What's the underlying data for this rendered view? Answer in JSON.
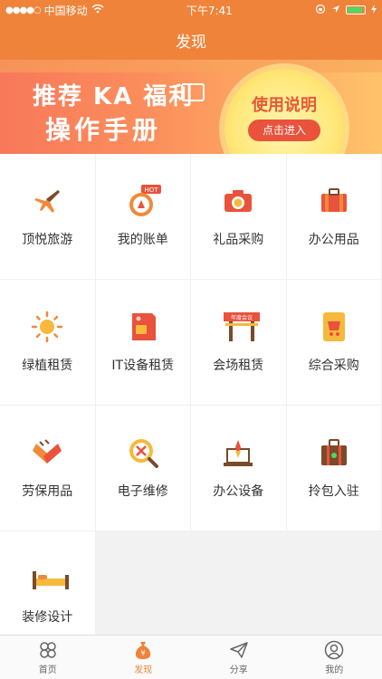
{
  "status": {
    "carrier": "中国移动",
    "time": "下午7:41"
  },
  "nav": {
    "title": "发现"
  },
  "banner": {
    "line1": "推荐 KA 福利",
    "line2": "操作手册",
    "badge_title": "使用说明",
    "badge_button": "点击进入"
  },
  "grid": [
    {
      "label": "顶悦旅游",
      "icon": "airplane-icon"
    },
    {
      "label": "我的账单",
      "icon": "compass-hot-icon",
      "badge": "HOT"
    },
    {
      "label": "礼品采购",
      "icon": "camera-icon"
    },
    {
      "label": "办公用品",
      "icon": "briefcase-icon"
    },
    {
      "label": "绿植租赁",
      "icon": "sun-icon"
    },
    {
      "label": "IT设备租赁",
      "icon": "sim-card-icon"
    },
    {
      "label": "会场租赁",
      "icon": "conference-stage-icon",
      "sign": "年度会议"
    },
    {
      "label": "综合采购",
      "icon": "shopping-cart-icon"
    },
    {
      "label": "劳保用品",
      "icon": "gloves-icon"
    },
    {
      "label": "电子维修",
      "icon": "repair-tools-icon"
    },
    {
      "label": "办公设备",
      "icon": "laptop-rocket-icon"
    },
    {
      "label": "拎包入驻",
      "icon": "suitcase-icon"
    },
    {
      "label": "装修设计",
      "icon": "bed-icon"
    }
  ],
  "tabs": [
    {
      "label": "首页",
      "icon": "home-clover-icon",
      "active": false
    },
    {
      "label": "发现",
      "icon": "money-bag-icon",
      "active": true
    },
    {
      "label": "分享",
      "icon": "paper-plane-icon",
      "active": false
    },
    {
      "label": "我的",
      "icon": "user-icon",
      "active": false
    }
  ],
  "colors": {
    "accent": "#f0833a",
    "tab_active": "#f0833a"
  }
}
